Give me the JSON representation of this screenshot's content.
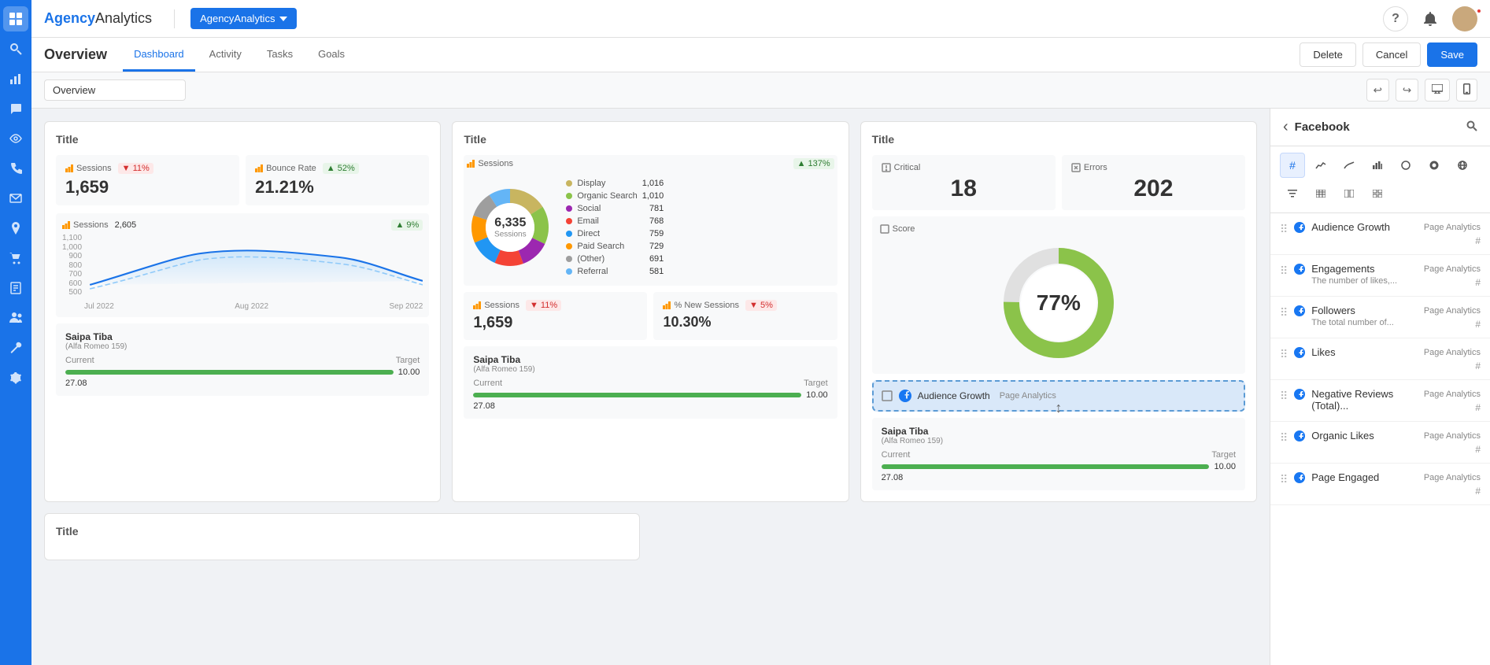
{
  "sidebar": {
    "icons": [
      {
        "name": "grid-icon",
        "symbol": "⊞",
        "active": true
      },
      {
        "name": "search-icon",
        "symbol": "🔍"
      },
      {
        "name": "chart-icon",
        "symbol": "📊"
      },
      {
        "name": "chat-icon",
        "symbol": "💬"
      },
      {
        "name": "eye-icon",
        "symbol": "👁"
      },
      {
        "name": "phone-icon",
        "symbol": "📞"
      },
      {
        "name": "mail-icon",
        "symbol": "✉"
      },
      {
        "name": "pin-icon",
        "symbol": "📍"
      },
      {
        "name": "cart-icon",
        "symbol": "🛒"
      },
      {
        "name": "doc-icon",
        "symbol": "📄"
      },
      {
        "name": "people-icon",
        "symbol": "👥"
      },
      {
        "name": "tools-icon",
        "symbol": "🔧"
      },
      {
        "name": "settings-icon",
        "symbol": "⚙"
      }
    ]
  },
  "topbar": {
    "logo_bold": "Agency",
    "logo_light": "Analytics",
    "agency_name": "AgencyAnalytics",
    "help_icon": "?",
    "notif_icon": "🔔"
  },
  "nav": {
    "title": "Overview",
    "tabs": [
      {
        "label": "Dashboard",
        "active": true
      },
      {
        "label": "Activity"
      },
      {
        "label": "Tasks"
      },
      {
        "label": "Goals"
      }
    ],
    "actions": {
      "delete": "Delete",
      "cancel": "Cancel",
      "save": "Save"
    }
  },
  "toolbar": {
    "input_value": "Overview"
  },
  "widget1": {
    "title": "Title",
    "sessions": {
      "label": "Sessions",
      "badge": "▼ 11%",
      "badge_type": "red",
      "value": "1,659"
    },
    "bounce_rate": {
      "label": "Bounce Rate",
      "badge": "▲ 52%",
      "badge_type": "green",
      "value": "21.21%"
    },
    "chart_sessions": {
      "label": "Sessions",
      "value": "2,605",
      "badge": "▲ 9%",
      "badge_type": "green",
      "y_labels": [
        "1,100",
        "1,000",
        "900",
        "800",
        "700",
        "600",
        "500"
      ],
      "x_labels": [
        "Jul 2022",
        "Aug 2022",
        "Sep 2022"
      ]
    },
    "goal1": {
      "name": "Saipa Tiba",
      "sub": "(Alfa Romeo 159)",
      "current_label": "Current",
      "target_label": "Target",
      "current_val": "27.08",
      "target_val": "10.00",
      "progress": 100
    }
  },
  "widget2": {
    "title": "Title",
    "donut": {
      "center_value": "6,335",
      "center_label": "Sessions",
      "total": 6335,
      "segments": [
        {
          "label": "Display",
          "value": 1016,
          "color": "#c8b560"
        },
        {
          "label": "Organic Search",
          "value": 1010,
          "color": "#8bc34a"
        },
        {
          "label": "Social",
          "value": 781,
          "color": "#9c27b0"
        },
        {
          "label": "Email",
          "value": 768,
          "color": "#f44336"
        },
        {
          "label": "Direct",
          "value": 759,
          "color": "#2196f3"
        },
        {
          "label": "Paid Search",
          "value": 729,
          "color": "#ff9800"
        },
        {
          "label": "(Other)",
          "value": 691,
          "color": "#9e9e9e"
        },
        {
          "label": "Referral",
          "value": 581,
          "color": "#64b5f6"
        }
      ],
      "badge": "▲ 137%",
      "badge_type": "green"
    },
    "mini": {
      "sessions": {
        "label": "Sessions",
        "badge": "▼ 11%",
        "badge_type": "red",
        "value": "1,659"
      },
      "new_sessions": {
        "label": "% New Sessions",
        "badge": "▼ 5%",
        "badge_type": "red",
        "value": "10.30%"
      }
    },
    "goal": {
      "name": "Saipa Tiba",
      "sub": "(Alfa Romeo 159)",
      "current_val": "27.08",
      "target_val": "10.00",
      "progress": 100
    }
  },
  "widget3": {
    "title": "Title",
    "critical": {
      "label": "Critical",
      "value": "18"
    },
    "errors": {
      "label": "Errors",
      "value": "202"
    },
    "score": {
      "label": "Score",
      "value": "77%",
      "percent": 77
    },
    "audience_growth": {
      "label": "Audience Growth",
      "sub": "Page Analytics",
      "dragging": true
    },
    "goal": {
      "name": "Saipa Tiba",
      "sub": "(Alfa Romeo 159)",
      "current_val": "27.08",
      "target_val": "10.00",
      "progress": 100
    }
  },
  "right_panel": {
    "back_icon": "‹",
    "title": "Facebook",
    "search_icon": "🔍",
    "icons": [
      {
        "name": "hash-icon",
        "symbol": "#",
        "active": true
      },
      {
        "name": "line-chart-icon",
        "symbol": "📈"
      },
      {
        "name": "curve-icon",
        "symbol": "〜"
      },
      {
        "name": "bar-chart-icon",
        "symbol": "📊"
      },
      {
        "name": "circle-icon",
        "symbol": "○"
      },
      {
        "name": "pie-icon",
        "symbol": "◑"
      },
      {
        "name": "globe-icon",
        "symbol": "🌐"
      },
      {
        "name": "filter-icon",
        "symbol": "≡"
      },
      {
        "name": "table-icon",
        "symbol": "⊞"
      },
      {
        "name": "split-icon",
        "symbol": "⊟"
      },
      {
        "name": "grid2-icon",
        "symbol": "▦"
      }
    ],
    "items": [
      {
        "name": "Audience Growth",
        "sub": "",
        "badge": "Page Analytics",
        "hash": true
      },
      {
        "name": "Engagements",
        "sub": "The number of likes,...",
        "badge": "Page Analytics",
        "hash": true
      },
      {
        "name": "Followers",
        "sub": "The total number of...",
        "badge": "Page Analytics",
        "hash": true
      },
      {
        "name": "Likes",
        "sub": "",
        "badge": "Page Analytics",
        "hash": true
      },
      {
        "name": "Negative Reviews (Total)...",
        "sub": "",
        "badge": "Page Analytics",
        "hash": true
      },
      {
        "name": "Organic Likes",
        "sub": "",
        "badge": "Page Analytics",
        "hash": true
      },
      {
        "name": "Page Engaged",
        "sub": "",
        "badge": "Page Analytics",
        "hash": true
      }
    ]
  }
}
